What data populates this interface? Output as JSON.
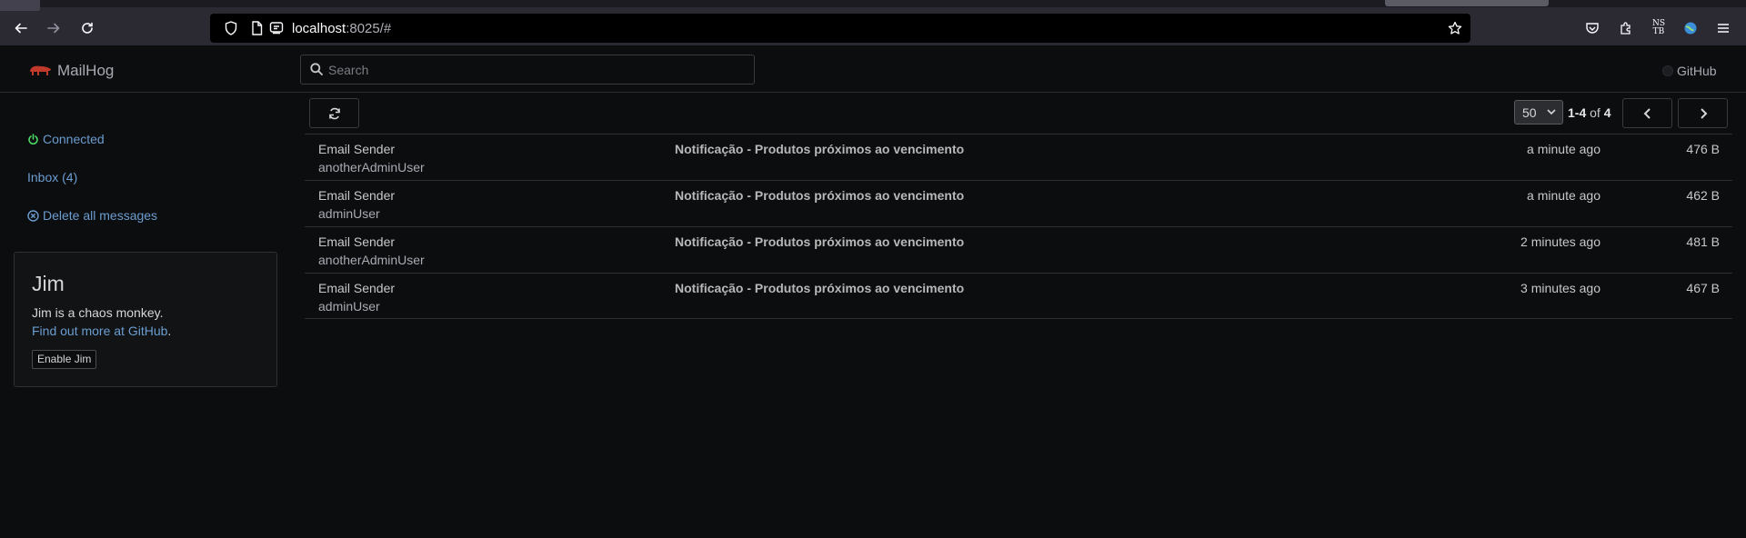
{
  "browser": {
    "url_host": "localhost",
    "url_rest": ":8025/#",
    "extension_label_top": "NS",
    "extension_label_bottom": "TB"
  },
  "header": {
    "brand": "MailHog",
    "search_placeholder": "Search",
    "github_label": "GitHub"
  },
  "sidebar": {
    "connected_label": "Connected",
    "inbox_label": "Inbox (4)",
    "delete_all_label": "Delete all messages"
  },
  "jim": {
    "title": "Jim",
    "description": "Jim is a chaos monkey.",
    "link_text": "Find out more at GitHub",
    "link_suffix": ".",
    "button_label": "Enable Jim"
  },
  "toolbar": {
    "per_page": "50",
    "range": "1-4",
    "of_label": "of",
    "total": "4"
  },
  "messages": [
    {
      "from": "Email Sender",
      "to": "anotherAdminUser",
      "subject": "Notificação - Produtos próximos ao vencimento",
      "time": "a minute ago",
      "size": "476 B"
    },
    {
      "from": "Email Sender",
      "to": "adminUser",
      "subject": "Notificação - Produtos próximos ao vencimento",
      "time": "a minute ago",
      "size": "462 B"
    },
    {
      "from": "Email Sender",
      "to": "anotherAdminUser",
      "subject": "Notificação - Produtos próximos ao vencimento",
      "time": "2 minutes ago",
      "size": "481 B"
    },
    {
      "from": "Email Sender",
      "to": "adminUser",
      "subject": "Notificação - Produtos próximos ao vencimento",
      "time": "3 minutes ago",
      "size": "467 B"
    }
  ],
  "colors": {
    "background": "#0c0d0f",
    "link": "#6b9dd0",
    "connected_icon": "#4cd964",
    "brand_logo": "#c0392b"
  }
}
